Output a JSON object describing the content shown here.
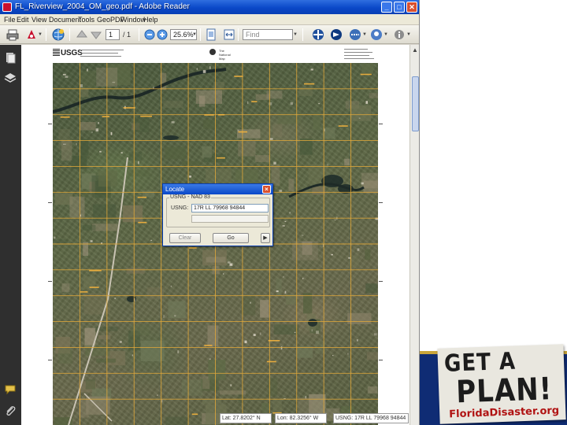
{
  "window": {
    "title": "FL_Riverview_2004_OM_geo.pdf - Adobe Reader",
    "buttons": {
      "minimize": "_",
      "maximize": "□",
      "close": "✕"
    }
  },
  "menubar": {
    "items": [
      "File",
      "Edit",
      "View",
      "Document",
      "Tools",
      "GeoPDF",
      "Window",
      "Help"
    ]
  },
  "toolbar": {
    "page_number": "1",
    "page_total": "/ 1",
    "zoom": "25.6%",
    "find_placeholder": "Find"
  },
  "map": {
    "header_logo": "USGS",
    "header_org": "The National Map"
  },
  "dialog": {
    "title": "Locate",
    "group_label": "USNG - NAD 83",
    "field_label": "USNG:",
    "field_value": "17R LL 79968 94844",
    "clear_label": "Clear",
    "go_label": "Go",
    "more_label": "▶"
  },
  "statusbar": {
    "lat": "Lat: 27.8202° N",
    "lon": "Lon: 82.3256° W",
    "usng": "USNG: 17R LL 79968 94844"
  },
  "promo": {
    "line1": "GET A",
    "line2": "PLAN!",
    "line3": "FloridaDisaster.org"
  },
  "colors": {
    "titlebar": "#0a48c8",
    "grid_lines": "#e0a83a",
    "promo_band": "#0f2c74",
    "promo_url": "#b01212"
  }
}
